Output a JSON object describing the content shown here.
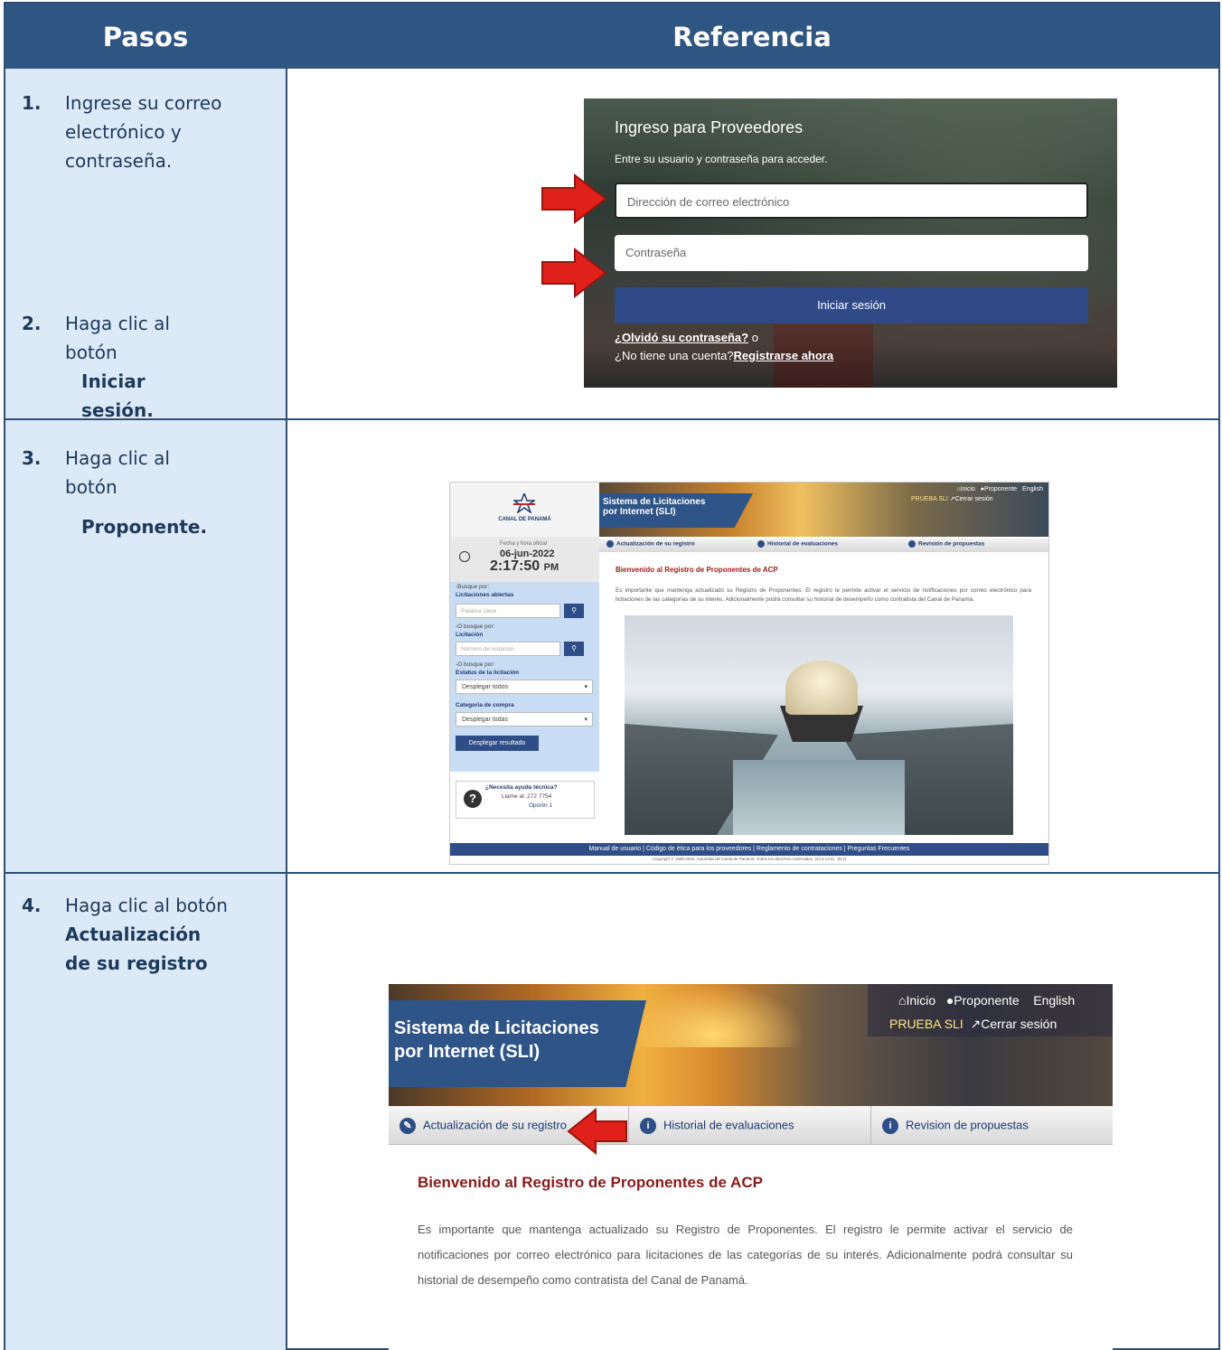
{
  "header": {
    "col1": "Pasos",
    "col2": "Referencia"
  },
  "steps": [
    {
      "num": "1.",
      "text": "Ingrese su correo electrónico y contraseña."
    },
    {
      "num": "2.",
      "text": "Haga clic al botón",
      "bold": "Iniciar sesión."
    },
    {
      "num": "3.",
      "text": "Haga clic al botón",
      "bold": "Proponente."
    },
    {
      "num": "4.",
      "text": "Haga clic al botón",
      "bold": "Actualización de su registro"
    }
  ],
  "login": {
    "title": "Ingreso para Proveedores",
    "subtitle": "Entre su usuario y contraseña para acceder.",
    "email_placeholder": "Dirección de correo electrónico",
    "password_placeholder": "Contraseña",
    "button": "Iniciar sesión",
    "forgot": "¿Olvidó su contraseña?",
    "or": "o",
    "no_account": "¿No tiene una cuenta?",
    "register": "Registrarse ahora"
  },
  "sli_small": {
    "logo_text": "CANAL DE PANAMÁ",
    "banner_title_1": "Sistema de Licitaciones",
    "banner_title_2": "por Internet (SLI)",
    "nav_inicio": "Inicio",
    "nav_proponente": "Proponente",
    "nav_english": "English",
    "user": "PRUEBA SLI",
    "logout": "Cerrar sesión",
    "date_label": "Fecha y hora oficial",
    "date": "06-jun-2022",
    "time": "2:17:50",
    "ampm": "PM",
    "search_by": "-Busque por:",
    "open_tenders": "Licitaciones abiertas",
    "keyword_placeholder": "Palabra clave",
    "or_search_1": "-O busque por:",
    "tender": "Licitación",
    "tender_placeholder": "Número de licitación",
    "or_search_2": "-O busque por:",
    "status_label": "Estatus de la licitación",
    "status_value": "Desplegar todos",
    "category_label": "Categoría de compra",
    "category_value": "Desplegar todas",
    "show_results": "Desplegar resultado",
    "help_title": "¿Necesita ayuda técnica?",
    "help_call": "Llame al: 272 7754",
    "help_option": "Opción 1",
    "tab1": "Actualización de su registro",
    "tab2": "Historial de evaluaciones",
    "tab3": "Revisión de propuestas",
    "welcome": "Bienvenido al Registro de Proponentes de ACP",
    "paragraph": "Es importante que mantenga actualizado su Registro de Proponentes. El registro le permite activar el servicio de notificaciones por correo electrónico para licitaciones de las categorías de su interés. Adicionalmente podrá consultar su historial de desempeño como contratista del Canal de Panamá.",
    "footer": "Manual de usuario  |  Código de ética para los proveedores  |  Reglamento de contrataciones  |  Preguntas Frecuentes",
    "copyright": "Copyright © 1999-2022. Autoridad del Canal de Panamá. Todos los derechos reservados. [v3.3.13.0] - [N:1]"
  },
  "sli_big": {
    "title_1": "Sistema de Licitaciones",
    "title_2": "por Internet (SLI)",
    "nav_inicio": "Inicio",
    "nav_proponente": "Proponente",
    "nav_english": "English",
    "user": "PRUEBA SLI",
    "logout": "Cerrar sesión",
    "tab1": "Actualización de su registro",
    "tab2": "Historial de evaluaciones",
    "tab3": "Revision de propuestas",
    "welcome": "Bienvenido al Registro de Proponentes de ACP",
    "paragraph": "Es importante que mantenga actualizado su Registro de Proponentes. El registro le permite activar el servicio de notificaciones por correo electrónico para licitaciones de las categorías de su interés. Adicionalmente podrá consultar su historial de desempeño como contratista del Canal de Panamá."
  },
  "colors": {
    "header_bg": "#2f5582",
    "left_col_bg": "#dce9f6",
    "arrow_red": "#e0201a",
    "button_blue": "#2f4a87"
  }
}
